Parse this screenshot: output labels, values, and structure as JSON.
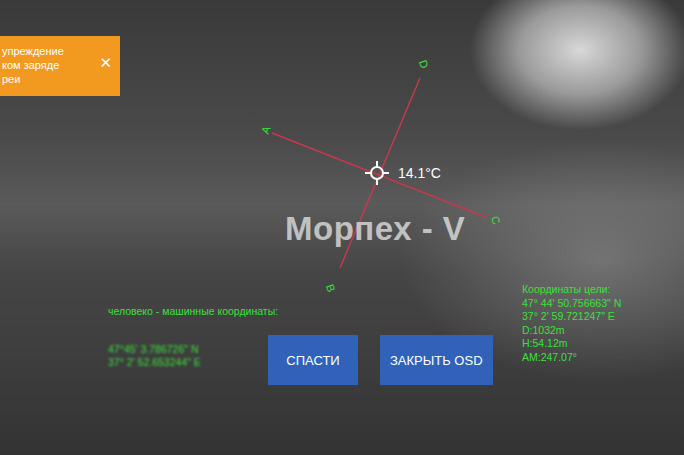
{
  "toast": {
    "lines": [
      "упреждение",
      "ком заряде",
      "реи"
    ],
    "close": "✕"
  },
  "reticle": {
    "labels": [
      "A",
      "B",
      "C",
      "D"
    ],
    "temperature": "14.1°C"
  },
  "watermark": "Морпех - V",
  "operator_coords": {
    "title": "человеко - машинные координаты:",
    "lines": [
      "47°45' 3.786726\" N",
      "37° 2' 52.653244\" E"
    ]
  },
  "target": {
    "title": "Координаты цели:",
    "lines": [
      "47° 44' 50.756663\" N",
      "37° 2' 59.721247\" E",
      "D:1032m",
      "H:54.12m",
      "AM:247.07°"
    ]
  },
  "buttons": [
    {
      "label": "СПАСТИ"
    },
    {
      "label": "ЗАКРЫТЬ OSD"
    }
  ]
}
